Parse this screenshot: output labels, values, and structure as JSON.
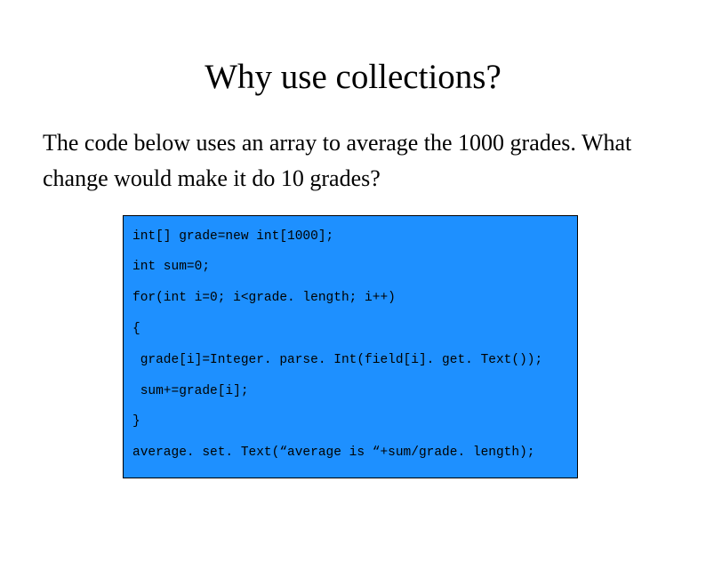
{
  "title": "Why use collections?",
  "paragraph": "The code below uses an array to average the 1000 grades.  What change would make it do 10 grades?",
  "code": {
    "line1": "int[] grade=new int[1000];",
    "line2": "int sum=0;",
    "line3": "for(int i=0; i<grade. length; i++)",
    "line4": "{",
    "line5": " grade[i]=Integer. parse. Int(field[i]. get. Text());",
    "line6": " sum+=grade[i];",
    "line7": "}",
    "line8": "average. set. Text(“average is “+sum/grade. length);"
  }
}
